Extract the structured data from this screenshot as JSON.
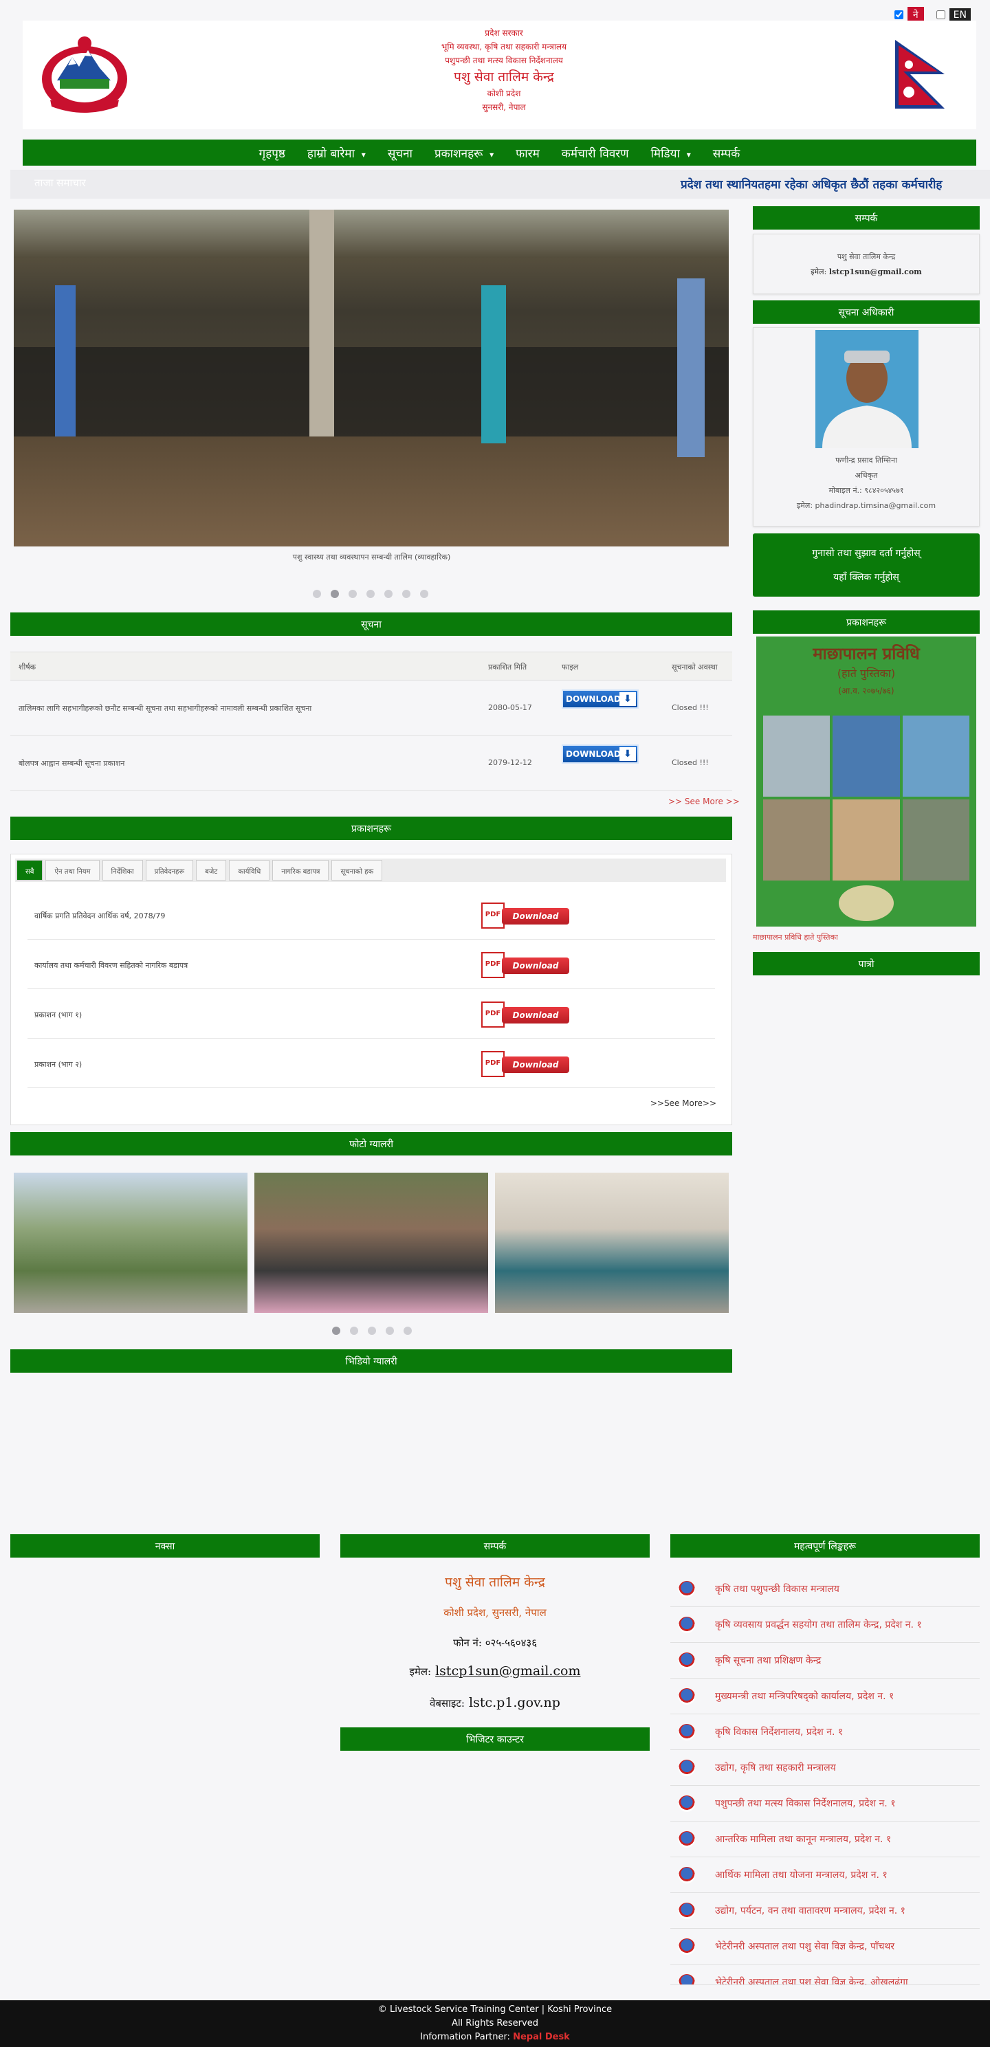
{
  "lang": {
    "ne": "ने",
    "en": "EN"
  },
  "header": {
    "line1": "प्रदेश सरकार",
    "line2": "भूमि व्यवस्था, कृषि तथा सहकारी मन्त्रालय",
    "line3": "पशुपन्छी तथा मत्स्य विकास निर्देशनालय",
    "title": "पशु सेवा तालिम केन्द्र",
    "line5": "कोशी प्रदेश",
    "line6": "सुनसरी, नेपाल"
  },
  "nav": [
    "गृहपृष्ठ",
    "हाम्रो बारेमा",
    "सूचना",
    "प्रकाशनहरू",
    "फारम",
    "कर्मचारी विवरण",
    "मिडिया",
    "सम्पर्क"
  ],
  "ticker": {
    "label": "ताजा समाचार",
    "text": "प्रदेश तथा स्थानियतहमा रहेका अधिकृत छैठौं तहका कर्मचारीह"
  },
  "slider": {
    "caption": "पशु स्वास्थ्य तथा व्यवस्थापन सम्बन्धी तालिम (व्यावहारिक)"
  },
  "notices": {
    "heading": "सूचना",
    "columns": [
      "शीर्षक",
      "प्रकाशित मिति",
      "फाइल",
      "सूचनाको अवस्था"
    ],
    "rows": [
      {
        "title": "तालिमका लागि सहभागीहरूको छनौट सम्बन्धी सूचना तथा सहभागीहरूको नामावली सम्बन्धी प्रकाशित सूचना",
        "date": "2080-05-17",
        "download": "DOWNLOAD",
        "status": "Closed !!!"
      },
      {
        "title": "बोलपत्र आह्वान सम्बन्धी सूचना प्रकाशन",
        "date": "2079-12-12",
        "download": "DOWNLOAD",
        "status": "Closed !!!"
      }
    ],
    "see_more": ">> See More >>"
  },
  "publications": {
    "heading": "प्रकाशनहरू",
    "tabs": [
      "सबै",
      "ऐन तथा नियम",
      "निर्देशिका",
      "प्रतिवेदनहरू",
      "बजेट",
      "कार्यविधि",
      "नागरिक बडापत्र",
      "सूचनाको हक"
    ],
    "rows": [
      {
        "title": "वार्षिक प्रगति प्रतिवेदन आर्थिक वर्ष, 2078/79",
        "btn": "Download"
      },
      {
        "title": "कार्यालय तथा कर्मचारी विवरण सहितको नागरिक बडापत्र",
        "btn": "Download"
      },
      {
        "title": "प्रकाशन (भाग १)",
        "btn": "Download"
      },
      {
        "title": "प्रकाशन (भाग २)",
        "btn": "Download"
      }
    ],
    "see_more": ">>See More>>"
  },
  "gallery": {
    "heading": "फोटो ग्यालरी"
  },
  "video": {
    "heading": "भिडियो ग्यालरी"
  },
  "sidebar": {
    "info_heading": "सम्पर्क",
    "info_office": "पशु सेवा तालिम केन्द्र",
    "info_email_label": "इमेल:",
    "info_email": "lstcp1sun@gmail.com",
    "chief_heading": "सूचना अधिकारी",
    "chief_name": "फणीन्द्र प्रसाद तिम्सिना",
    "chief_role": "अधिकृत",
    "chief_phone": "मोबाइल नं.: ९८४२०५४५७१",
    "chief_email": "इमेल: phadindrap.timsina@gmail.com",
    "portal_text1": "गुनासो तथा सुझाव दर्ता गर्नुहोस्",
    "portal_text2": "यहाँ क्लिक गर्नुहोस्",
    "book_heading": "प्रकाशनहरू",
    "book_title": "माछापालन प्रविधि",
    "book_subtitle": "(हाते पुस्तिका)",
    "book_year": "(आ.व. २०७५/७६)",
    "book_link": "माछापालन प्रविधि हाते पुस्तिका",
    "calendar_heading": "पात्रो"
  },
  "footer": {
    "col1_heading": "नक्सा",
    "col2_heading": "सम्पर्क",
    "col3_heading": "महत्वपूर्ण लिङ्कहरू",
    "org": "पशु सेवा तालिम केन्द्र",
    "addr": "कोशी प्रदेश, सुनसरी, नेपाल",
    "phone_label": "फोन नं:",
    "phone": "०२५-५६०४३६",
    "email_label": "इमेल:",
    "email": "lstcp1sun@gmail.com",
    "web_label": "वेबसाइट:",
    "web": "lstc.p1.gov.np",
    "visitors_heading": "भिजिटर काउन्टर",
    "links": [
      "कृषि तथा पशुपन्छी विकास मन्त्रालय",
      "कृषि व्यवसाय प्रवर्द्धन सहयोग तथा तालिम केन्द्र, प्रदेश न. १",
      "कृषि सूचना तथा प्रशिक्षण केन्द्र",
      "मुख्यमन्त्री तथा मन्त्रिपरिषद्को कार्यालय, प्रदेश न. १",
      "कृषि विकास निर्देशनालय, प्रदेश न. १",
      "उद्योग, कृषि तथा सहकारी मन्त्रालय",
      "पशुपन्छी तथा मत्स्य विकास निर्देशनालय, प्रदेश न. १",
      "आन्तरिक मामिला तथा कानून मन्त्रालय, प्रदेश न. १",
      "आर्थिक मामिला तथा योजना मन्त्रालय, प्रदेश न. १",
      "उद्योग, पर्यटन, वन तथा वातावरण मन्त्रालय, प्रदेश न. १",
      "भेटेरीनरी अस्पताल तथा पशु सेवा विज्ञ केन्द्र, पाँचथर",
      "भेटेरीनरी अस्पताल तथा पशु सेवा विज्ञ केन्द्र, ओखलढुंगा"
    ]
  },
  "bottom": {
    "copyright": "© Livestock Service Training Center | Koshi Province",
    "rights": "All Rights Reserved",
    "partner_label": "Information Partner:",
    "partner": "Nepal Desk"
  }
}
